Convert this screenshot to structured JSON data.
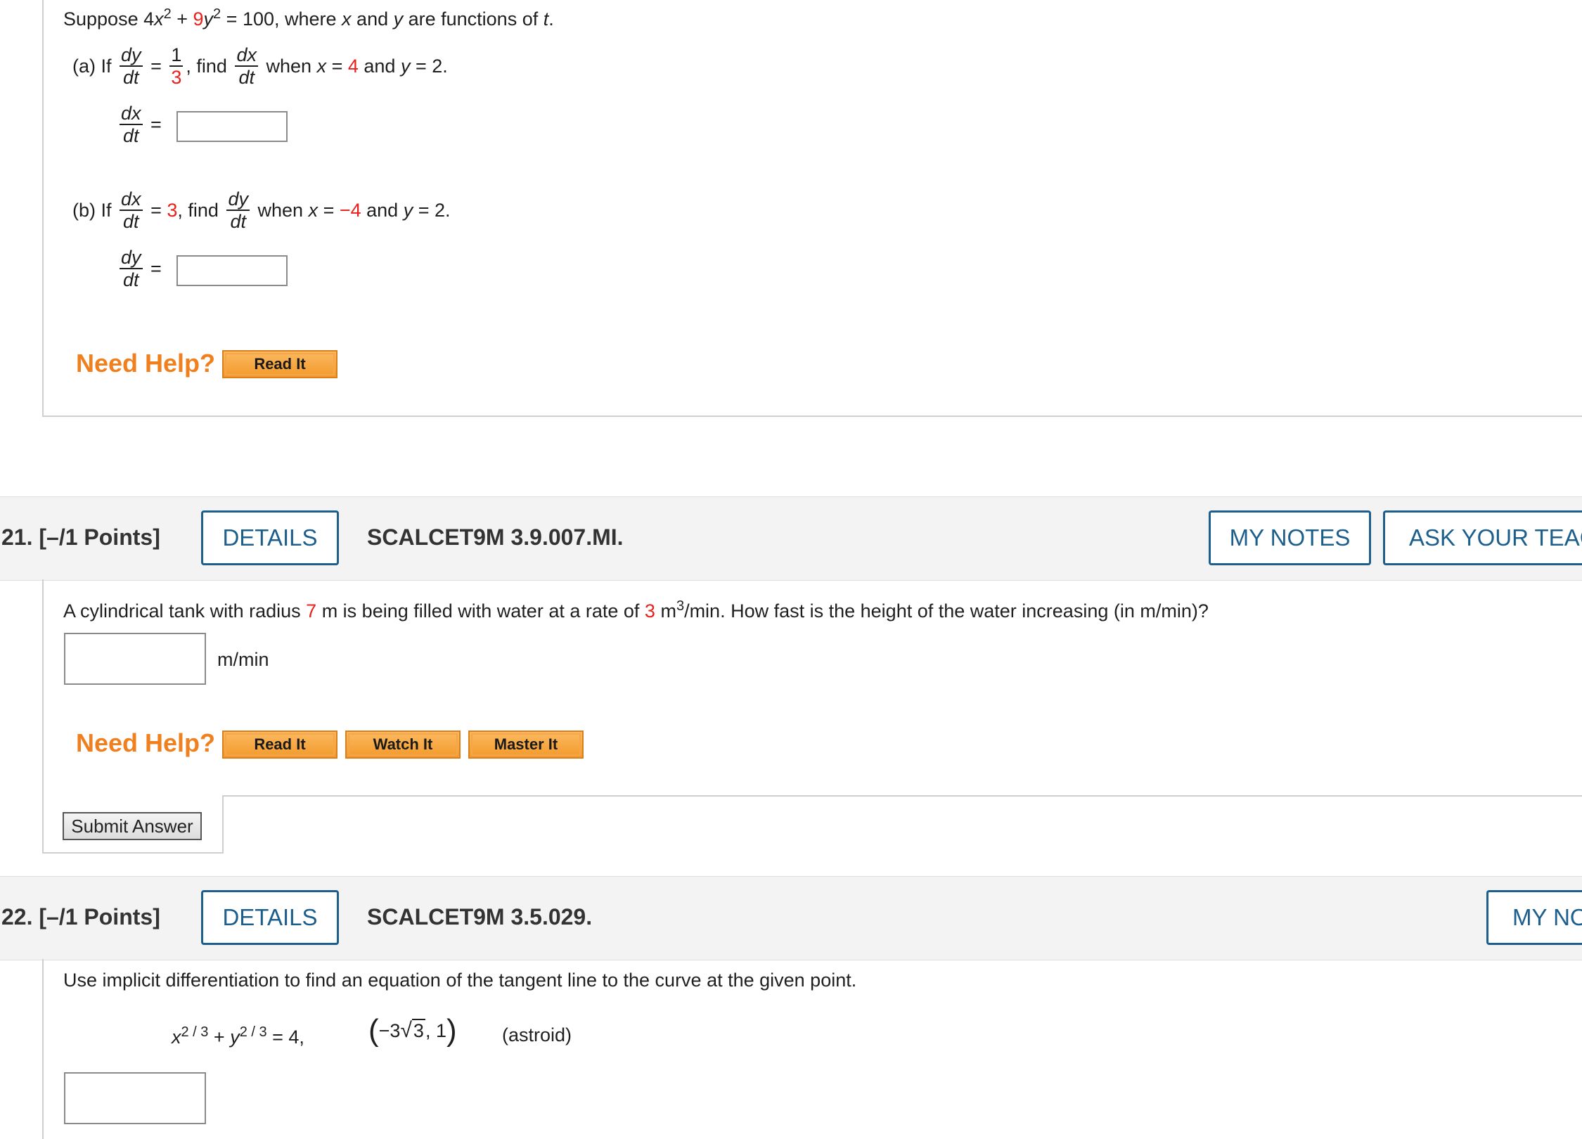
{
  "q20": {
    "intro_pre": "Suppose 4",
    "intro_x": "x",
    "intro_exp1": "2",
    "intro_plus": " + ",
    "intro_coef": "9",
    "intro_y": "y",
    "intro_exp2": "2",
    "intro_post": " = 100, where ",
    "intro_x2": "x",
    "intro_and": " and ",
    "intro_y2": "y",
    "intro_tail": " are functions of ",
    "intro_t": "t",
    "intro_dot": ".",
    "part_a": {
      "label": "(a)  If",
      "frac1_num": "dy",
      "frac1_den": "dt",
      "eq": "=",
      "frac2_num": "1",
      "frac2_den": "3",
      "find": ", find",
      "frac3_num": "dx",
      "frac3_den": "dt",
      "when": " when ",
      "xvar": "x",
      "eq2": " = ",
      "xval": "4",
      "and": " and ",
      "yvar": "y",
      "yval": " = 2.",
      "ans_num": "dx",
      "ans_den": "dt",
      "ans_eq": "="
    },
    "part_b": {
      "label": "(b)  If",
      "frac1_num": "dx",
      "frac1_den": "dt",
      "eq": "= ",
      "rate": "3",
      "find": ", find",
      "frac2_num": "dy",
      "frac2_den": "dt",
      "when": " when ",
      "xvar": "x",
      "eq2": " = ",
      "xval": "−4",
      "and": " and ",
      "yvar": "y",
      "yval": " = 2.",
      "ans_num": "dy",
      "ans_den": "dt",
      "ans_eq": "="
    },
    "need_help": "Need Help?",
    "read_it": "Read It"
  },
  "q21": {
    "number": "21.  [–/1 Points]",
    "details": "DETAILS",
    "code": "SCALCET9M 3.9.007.MI.",
    "my_notes": "MY NOTES",
    "ask_teacher": "ASK YOUR TEACHER",
    "text_pre": "A cylindrical tank with radius ",
    "radius": "7",
    "text_mid": " m is being filled with water at a rate of ",
    "rate": "3",
    "text_unit": " m",
    "text_exp": "3",
    "text_post": "/min. How fast is the height of the water increasing (in m/min)?",
    "unit": "m/min",
    "need_help": "Need Help?",
    "read_it": "Read It",
    "watch_it": "Watch It",
    "master_it": "Master It",
    "submit": "Submit Answer"
  },
  "q22": {
    "number": "22.  [–/1 Points]",
    "details": "DETAILS",
    "code": "SCALCET9M 3.5.029.",
    "my_notes": "MY NOTES",
    "text": "Use implicit differentiation to find an equation of the tangent line to the curve at the given point.",
    "eq_x": "x",
    "eq_exp1": "2 / 3",
    "eq_plus": " + ",
    "eq_y": "y",
    "eq_exp2": "2 / 3",
    "eq_rhs": " = 4,",
    "point_a": "−3",
    "point_rad": "3",
    "point_b": ", 1",
    "note": "(astroid)"
  }
}
